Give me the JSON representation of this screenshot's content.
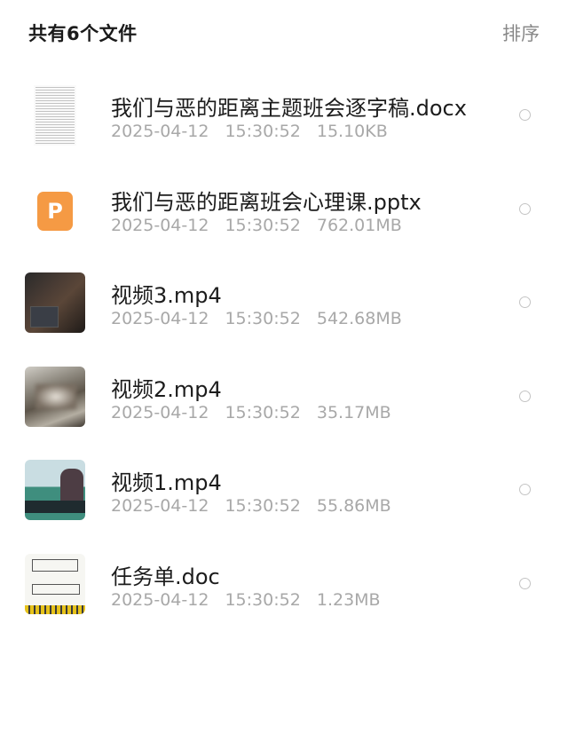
{
  "header": {
    "title": "共有6个文件",
    "sort_label": "排序"
  },
  "files": [
    {
      "name": "我们与恶的距离主题班会逐字稿.docx",
      "date": "2025-04-12",
      "time": "15:30:52",
      "size": "15.10KB",
      "icon": "docx-thumbnail"
    },
    {
      "name": "我们与恶的距离班会心理课.pptx",
      "date": "2025-04-12",
      "time": "15:30:52",
      "size": "762.01MB",
      "icon": "pptx-icon",
      "icon_letter": "P",
      "icon_color": "#f59a44"
    },
    {
      "name": "视频3.mp4",
      "date": "2025-04-12",
      "time": "15:30:52",
      "size": "542.68MB",
      "icon": "video-thumbnail"
    },
    {
      "name": "视频2.mp4",
      "date": "2025-04-12",
      "time": "15:30:52",
      "size": "35.17MB",
      "icon": "video-thumbnail"
    },
    {
      "name": "视频1.mp4",
      "date": "2025-04-12",
      "time": "15:30:52",
      "size": "55.86MB",
      "icon": "video-thumbnail"
    },
    {
      "name": "任务单.doc",
      "date": "2025-04-12",
      "time": "15:30:52",
      "size": "1.23MB",
      "icon": "doc-thumbnail"
    }
  ]
}
